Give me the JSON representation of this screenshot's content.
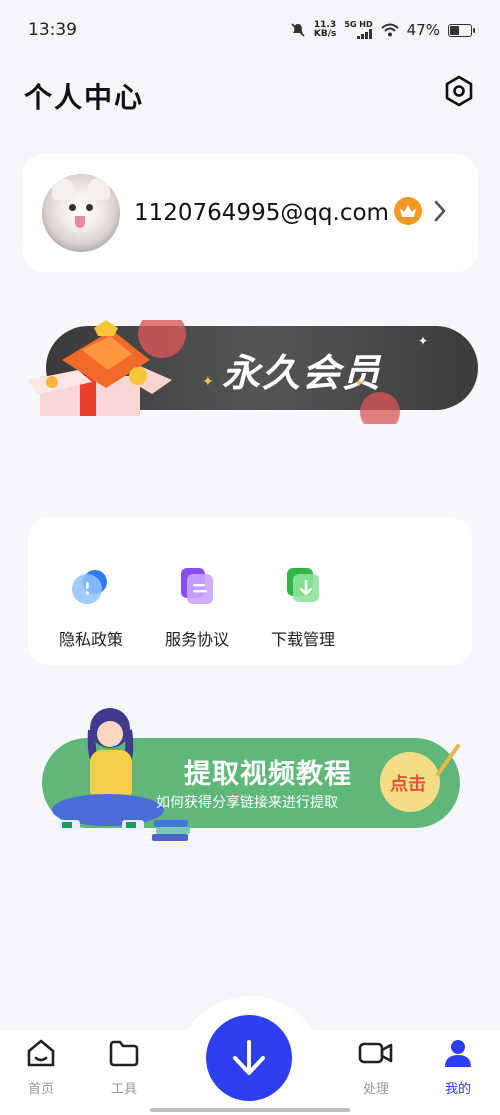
{
  "status": {
    "time": "13:39",
    "net_speed": "11.3",
    "net_unit": "KB/s",
    "signal_label": "5G HD",
    "battery": "47%",
    "battery_level": 0.47
  },
  "header": {
    "title": "个人中心"
  },
  "profile": {
    "email": "1120764995@qq.com"
  },
  "vip_banner": {
    "text": "永久会员"
  },
  "menu": {
    "items": [
      {
        "label": "隐私政策",
        "icon": "privacy-icon",
        "color": "#3b8ef0"
      },
      {
        "label": "服务协议",
        "icon": "agreement-icon",
        "color": "#8a5cf0"
      },
      {
        "label": "下载管理",
        "icon": "download-manage-icon",
        "color": "#3fc257"
      }
    ]
  },
  "tutorial": {
    "title": "提取视频教程",
    "subtitle": "如何获得分享链接来进行提取",
    "button": "点击"
  },
  "tabbar": {
    "items": [
      {
        "label": "首页",
        "icon": "home-icon"
      },
      {
        "label": "工具",
        "icon": "folder-icon"
      },
      {
        "label": "处理",
        "icon": "video-camera-icon"
      },
      {
        "label": "我的",
        "icon": "user-icon"
      }
    ],
    "active": "我的",
    "accent": "#2d3ff0"
  }
}
